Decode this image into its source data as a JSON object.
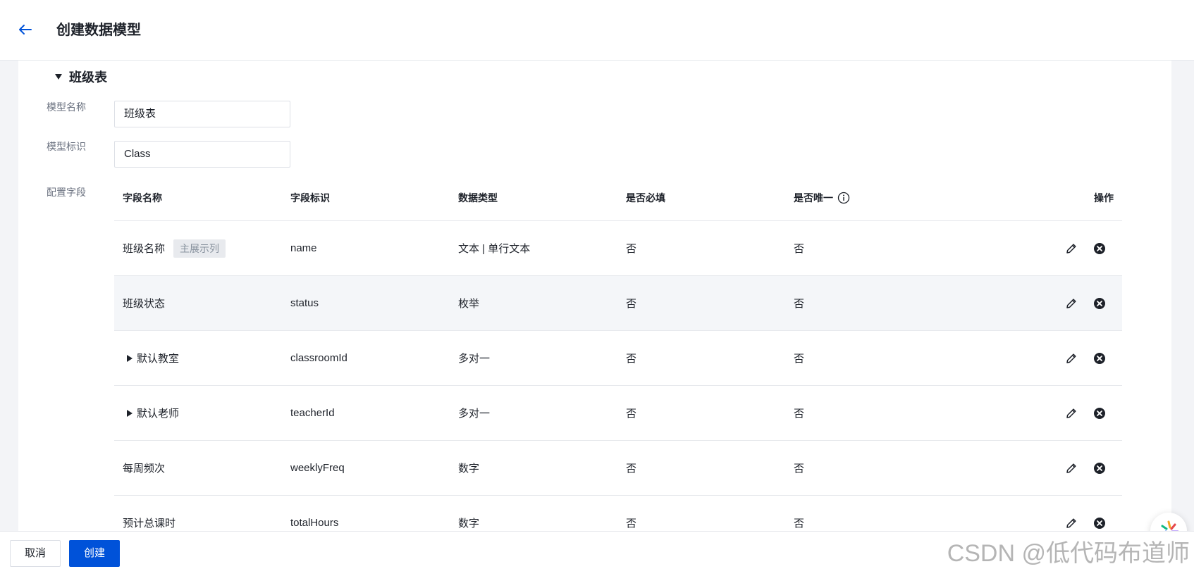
{
  "header": {
    "back_icon": "arrow-left-icon",
    "title": "创建数据模型"
  },
  "section": {
    "title": "班级表",
    "expanded": true
  },
  "form": {
    "model_name_label": "模型名称",
    "model_name_value": "班级表",
    "model_id_label": "模型标识",
    "model_id_value": "Class",
    "fields_label": "配置字段"
  },
  "table": {
    "headers": {
      "field_name": "字段名称",
      "field_id": "字段标识",
      "data_type": "数据类型",
      "required": "是否必填",
      "unique": "是否唯一",
      "actions": "操作"
    },
    "rows": [
      {
        "name": "班级名称",
        "tag": "主展示列",
        "id": "name",
        "type": "文本 | 单行文本",
        "required": "否",
        "unique": "否",
        "expandable": false
      },
      {
        "name": "班级状态",
        "tag": "",
        "id": "status",
        "type": "枚举",
        "required": "否",
        "unique": "否",
        "expandable": false
      },
      {
        "name": "默认教室",
        "tag": "",
        "id": "classroomId",
        "type": "多对一",
        "required": "否",
        "unique": "否",
        "expandable": true
      },
      {
        "name": "默认老师",
        "tag": "",
        "id": "teacherId",
        "type": "多对一",
        "required": "否",
        "unique": "否",
        "expandable": true
      },
      {
        "name": "每周频次",
        "tag": "",
        "id": "weeklyFreq",
        "type": "数字",
        "required": "否",
        "unique": "否",
        "expandable": false
      },
      {
        "name": "预计总课时",
        "tag": "",
        "id": "totalHours",
        "type": "数字",
        "required": "否",
        "unique": "否",
        "expandable": false
      }
    ]
  },
  "footer": {
    "cancel_label": "取消",
    "create_label": "创建",
    "create_color": "#0052d9"
  },
  "watermark": "CSDN @低代码布道师"
}
